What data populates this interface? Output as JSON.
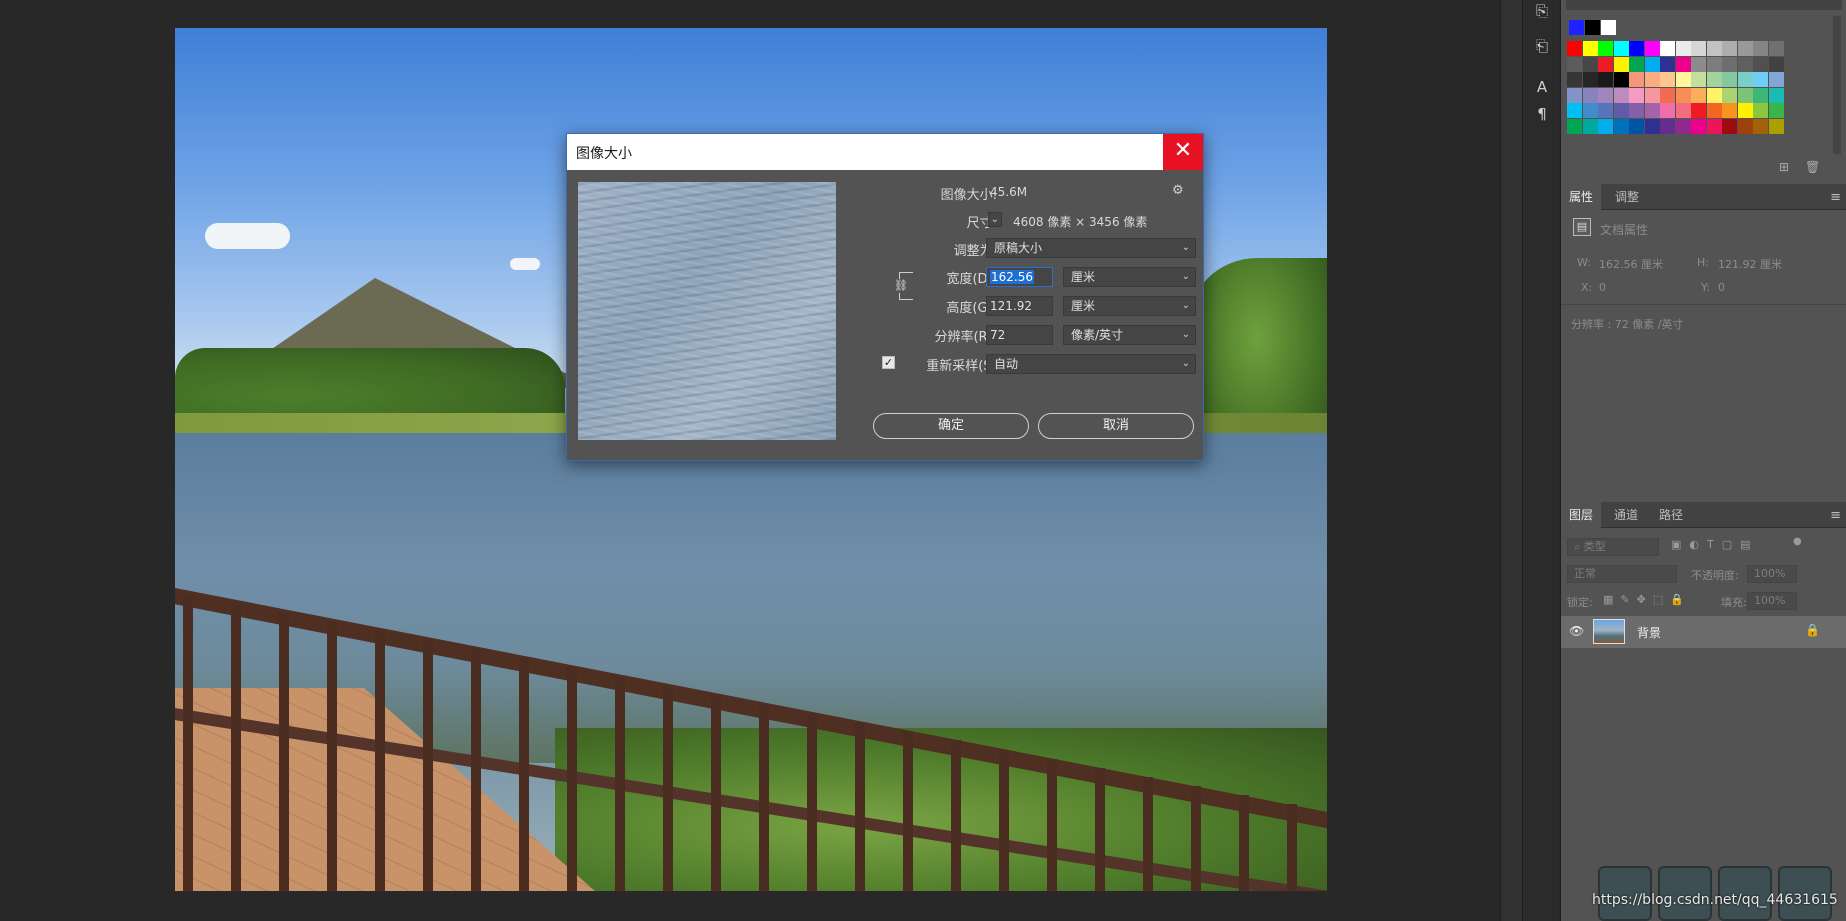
{
  "dialog": {
    "title": "图像大小",
    "close_icon": "close-icon",
    "image_size_label": "图像大小:",
    "image_size_value": "45.6M",
    "dimensions_label": "尺寸:",
    "dimensions_value": "4608 像素 × 3456 像素",
    "fit_to_label": "调整为:",
    "fit_to_value": "原稿大小",
    "width_label": "宽度(D):",
    "width_value": "162.56",
    "width_unit": "厘米",
    "height_label": "高度(G):",
    "height_value": "121.92",
    "height_unit": "厘米",
    "resolution_label": "分辨率(R):",
    "resolution_value": "72",
    "resolution_unit": "像素/英寸",
    "resample_label": "重新采样(S):",
    "resample_value": "自动",
    "resample_checked": true,
    "ok_label": "确定",
    "cancel_label": "取消"
  },
  "properties_panel": {
    "tabs": [
      "属性",
      "调整"
    ],
    "doc_props": "文档属性",
    "w_label": "W:",
    "w_value": "162.56 厘米",
    "h_label": "H:",
    "h_value": "121.92 厘米",
    "x_label": "X:",
    "x_value": "0",
    "y_label": "Y:",
    "y_value": "0",
    "resolution": "分辨率 : 72 像素 /英寸"
  },
  "layers_panel": {
    "tabs": [
      "图层",
      "通道",
      "路径"
    ],
    "filter_placeholder": "类型",
    "blend_mode": "正常",
    "opacity_label": "不透明度:",
    "opacity_value": "100%",
    "lock_label": "锁定:",
    "fill_label": "填充:",
    "fill_value": "100%",
    "layer_name": "背景"
  },
  "watermark": "https://blog.csdn.net/qq_44631615",
  "colors": {
    "accent": "#2d6ec9",
    "close_red": "#e81123",
    "panel_bg": "#535353"
  }
}
